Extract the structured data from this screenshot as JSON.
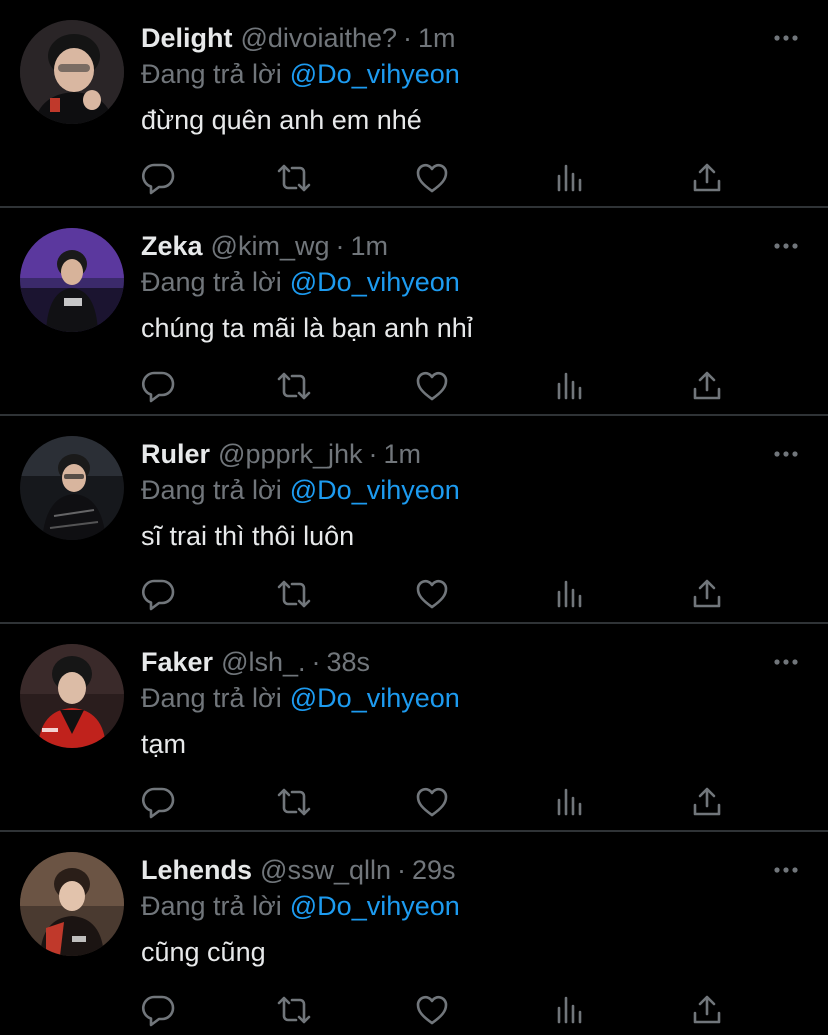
{
  "replies": [
    {
      "name": "Delight",
      "handle": "@divoiaithe?",
      "time": "1m",
      "replying_prefix": "Đang trả lời",
      "replying_to": "@Do_vihyeon",
      "text": "đừng quên anh em nhé"
    },
    {
      "name": "Zeka",
      "handle": "@kim_wg",
      "time": "1m",
      "replying_prefix": "Đang trả lời",
      "replying_to": "@Do_vihyeon",
      "text": "chúng ta mãi là bạn anh nhỉ"
    },
    {
      "name": "Ruler",
      "handle": "@ppprk_jhk",
      "time": "1m",
      "replying_prefix": "Đang trả lời",
      "replying_to": "@Do_vihyeon",
      "text": "sĩ trai thì thôi luôn"
    },
    {
      "name": "Faker",
      "handle": "@lsh_.",
      "time": "38s",
      "replying_prefix": "Đang trả lời",
      "replying_to": "@Do_vihyeon",
      "text": "tạm"
    },
    {
      "name": "Lehends",
      "handle": "@ssw_qlln",
      "time": "29s",
      "replying_prefix": "Đang trả lời",
      "replying_to": "@Do_vihyeon",
      "text": "cũng cũng"
    }
  ],
  "separator": "·",
  "icons": {
    "more": "more-dots-icon",
    "reply": "reply-bubble-icon",
    "retweet": "retweet-arrows-icon",
    "like": "heart-icon",
    "stats": "bar-chart-icon",
    "share": "share-upload-icon"
  },
  "colors": {
    "background": "#000000",
    "text": "#e7e9ea",
    "muted": "#71767b",
    "mention": "#1d9bf0",
    "divider": "#2f3336"
  }
}
